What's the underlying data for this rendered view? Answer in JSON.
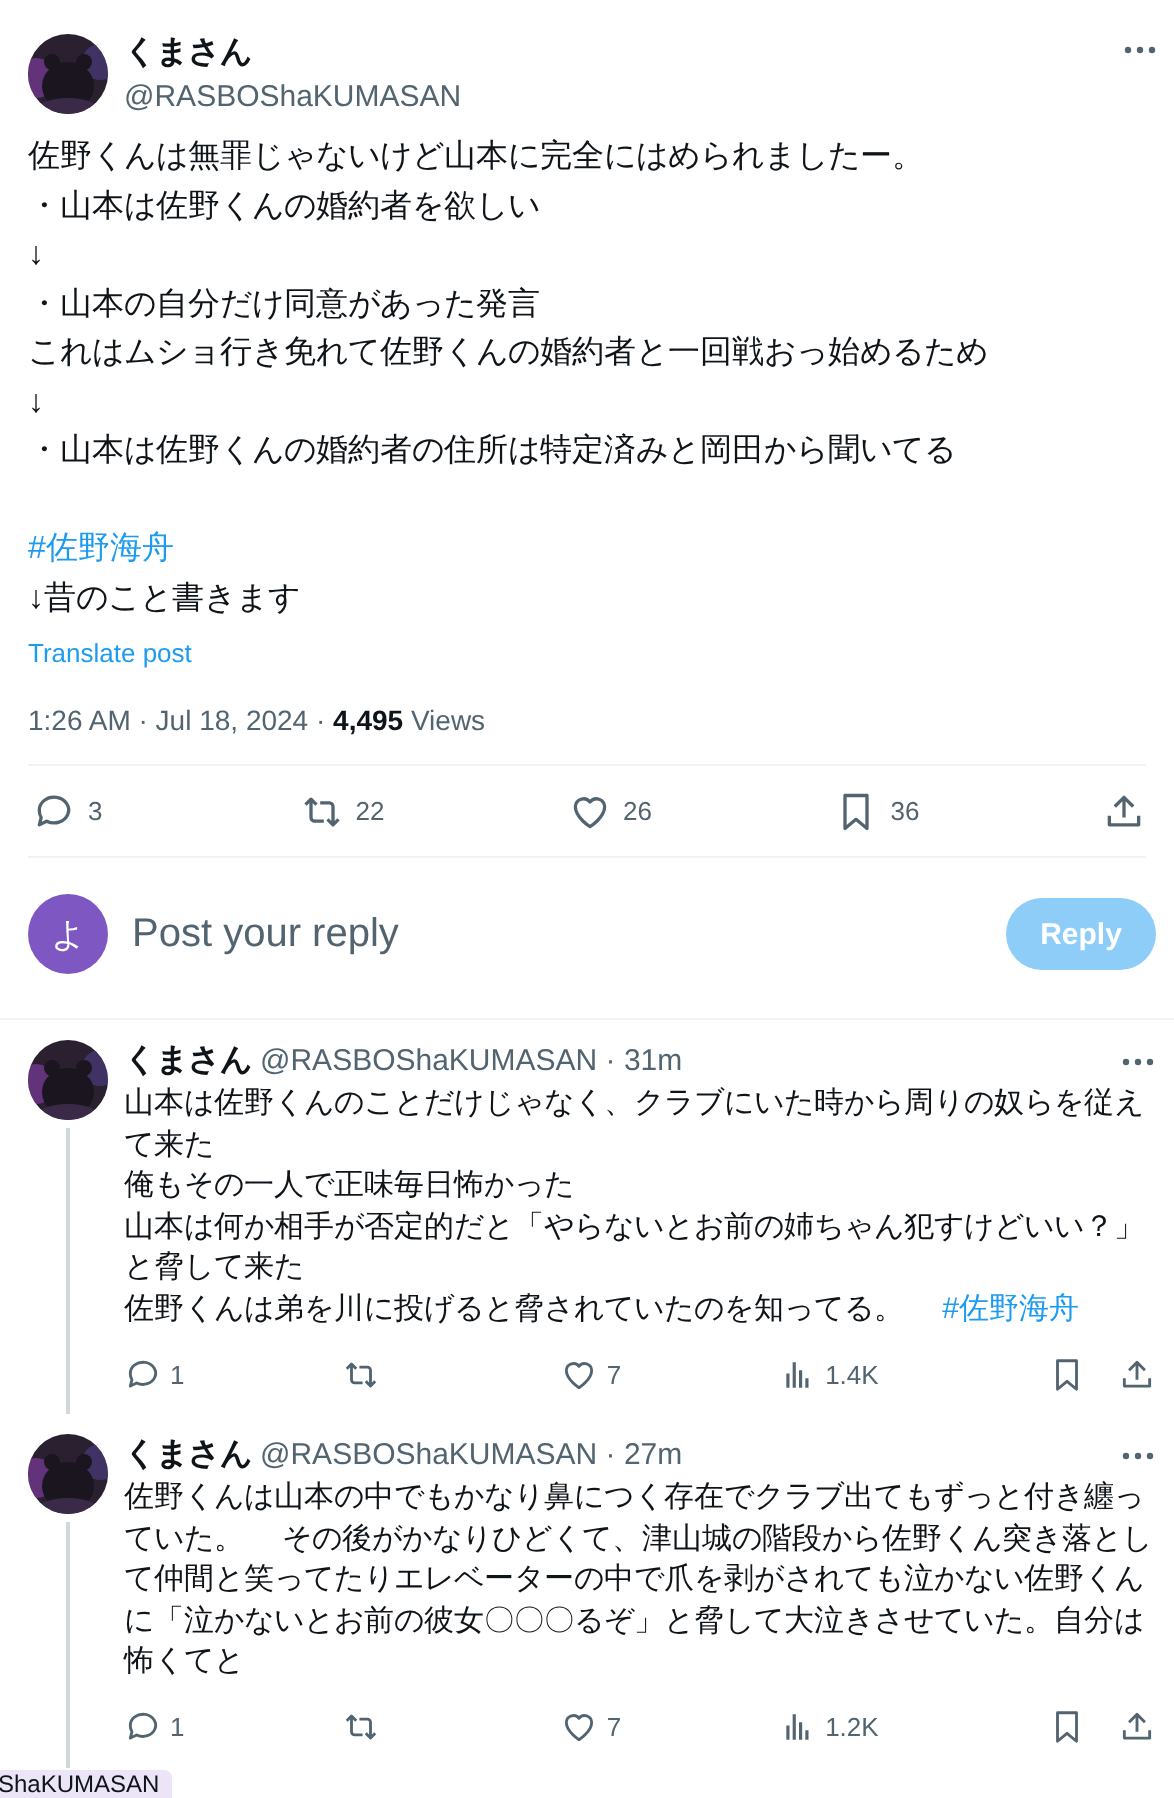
{
  "post": {
    "author": {
      "name": "くまさん",
      "handle": "@RASBOShaKUMASAN"
    },
    "body": [
      {
        "kind": "line",
        "parts": [
          {
            "kind": "text",
            "text": "佐野くんは無罪じゃないけど山本に完全にはめられましたー。"
          }
        ]
      },
      {
        "kind": "line",
        "parts": [
          {
            "kind": "text",
            "text": "・山本は佐野くんの婚約者を欲しい"
          }
        ]
      },
      {
        "kind": "line",
        "parts": [
          {
            "kind": "text",
            "text": "↓"
          }
        ]
      },
      {
        "kind": "line",
        "parts": [
          {
            "kind": "text",
            "text": "・山本の自分だけ同意があった発言"
          }
        ]
      },
      {
        "kind": "line",
        "parts": [
          {
            "kind": "text",
            "text": "これはムショ行き免れて佐野くんの婚約者と一回戦おっ始めるため"
          }
        ]
      },
      {
        "kind": "line",
        "parts": [
          {
            "kind": "text",
            "text": "↓"
          }
        ]
      },
      {
        "kind": "line",
        "parts": [
          {
            "kind": "text",
            "text": "・山本は佐野くんの婚約者の住所は特定済みと岡田から聞いてる"
          }
        ]
      },
      {
        "kind": "gap"
      },
      {
        "kind": "line",
        "parts": [
          {
            "kind": "hashtag",
            "text": "#佐野海舟"
          }
        ]
      },
      {
        "kind": "line",
        "parts": [
          {
            "kind": "text",
            "text": "↓昔のこと書きます"
          }
        ]
      }
    ],
    "translate": "Translate post",
    "time": "1:26 AM · Jul 18, 2024 · ",
    "views_count": "4,495",
    "views_label": " Views",
    "actions": [
      {
        "kind": "reply",
        "count": "3"
      },
      {
        "kind": "repost",
        "count": "22"
      },
      {
        "kind": "like",
        "count": "26"
      },
      {
        "kind": "bookmark",
        "count": "36"
      },
      {
        "kind": "share"
      }
    ]
  },
  "composer": {
    "avatar_letter": "よ",
    "placeholder": "Post your reply",
    "button": "Reply"
  },
  "replies": [
    {
      "name": "くまさん",
      "handle": "@RASBOShaKUMASAN · 31m",
      "body": [
        {
          "kind": "line",
          "parts": [
            {
              "kind": "text",
              "text": "山本は佐野くんのことだけじゃなく、クラブにいた時から周りの奴らを従えて来た"
            }
          ]
        },
        {
          "kind": "line",
          "parts": [
            {
              "kind": "text",
              "text": "俺もその一人で正味毎日怖かった"
            }
          ]
        },
        {
          "kind": "line",
          "parts": [
            {
              "kind": "text",
              "text": "山本は何か相手が否定的だと「やらないとお前の姉ちゃん犯すけどいい？」と脅して来た"
            }
          ]
        },
        {
          "kind": "line",
          "parts": [
            {
              "kind": "text",
              "text": "佐野くんは弟を川に投げると脅されていたのを知ってる。　 "
            },
            {
              "kind": "hashtag",
              "text": "#佐野海舟"
            }
          ]
        }
      ],
      "actions": [
        {
          "kind": "reply",
          "count": "1"
        },
        {
          "kind": "repost"
        },
        {
          "kind": "like",
          "count": "7"
        },
        {
          "kind": "views",
          "count": "1.4K"
        },
        {
          "kind": "bookmark"
        },
        {
          "kind": "share"
        }
      ]
    },
    {
      "name": "くまさん",
      "handle": "@RASBOShaKUMASAN · 27m",
      "body": [
        {
          "kind": "line",
          "parts": [
            {
              "kind": "text",
              "text": "佐野くんは山本の中でもかなり鼻につく存在でクラブ出てもずっと付き纏っていた。　 その後がかなりひどくて、津山城の階段から佐野くん突き落として仲間と笑ってたりエレベーターの中で爪を剥がされても泣かない佐野くんに「泣かないとお前の彼女〇〇〇るぞ」と脅して大泣きさせていた。自分は怖くてと"
            }
          ]
        }
      ],
      "actions": [
        {
          "kind": "reply",
          "count": "1"
        },
        {
          "kind": "repost"
        },
        {
          "kind": "like",
          "count": "7"
        },
        {
          "kind": "views",
          "count": "1.2K"
        },
        {
          "kind": "bookmark"
        },
        {
          "kind": "share"
        }
      ]
    }
  ],
  "link_tooltip": "ShaKUMASAN"
}
